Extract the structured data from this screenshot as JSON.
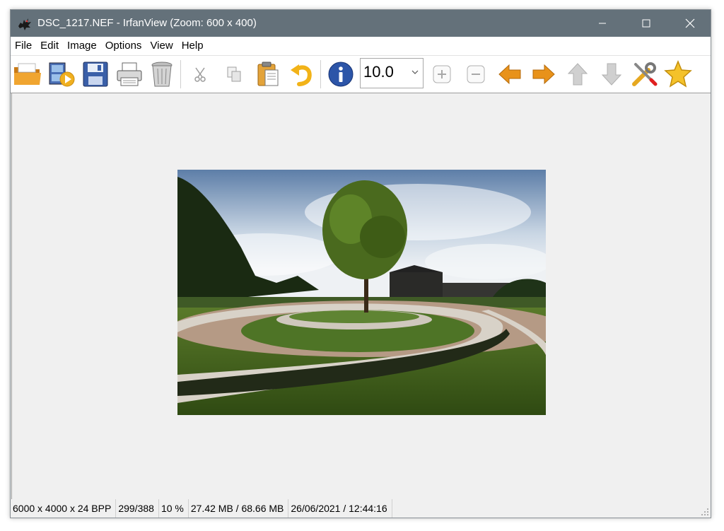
{
  "window": {
    "title": "DSC_1217.NEF - IrfanView (Zoom: 600 x 400)",
    "icon": "irfanview-cat-icon",
    "controls": [
      "minimize-icon",
      "maximize-icon",
      "close-icon"
    ]
  },
  "menu": {
    "items": [
      {
        "label": "File"
      },
      {
        "label": "Edit"
      },
      {
        "label": "Image"
      },
      {
        "label": "Options"
      },
      {
        "label": "View"
      },
      {
        "label": "Help"
      }
    ]
  },
  "toolbar": {
    "buttons": [
      {
        "icon": "open-folder-icon"
      },
      {
        "icon": "slideshow-icon"
      },
      {
        "icon": "save-floppy-icon"
      },
      {
        "icon": "print-icon"
      },
      {
        "icon": "delete-trash-icon"
      },
      {
        "icon": "cut-scissors-icon"
      },
      {
        "icon": "copy-icon"
      },
      {
        "icon": "paste-clipboard-icon"
      },
      {
        "icon": "undo-arrow-icon"
      },
      {
        "icon": "info-icon"
      },
      {
        "icon": "zoom-in-icon"
      },
      {
        "icon": "zoom-out-icon"
      },
      {
        "icon": "previous-arrow-icon"
      },
      {
        "icon": "next-arrow-icon"
      },
      {
        "icon": "up-arrow-icon"
      },
      {
        "icon": "down-arrow-icon"
      },
      {
        "icon": "properties-tools-icon"
      },
      {
        "icon": "favorites-star-icon"
      }
    ],
    "zoom_value": "10.0"
  },
  "image": {
    "description": "wide-angle photo of circular park lawn with tree"
  },
  "status": {
    "dimensions": "6000 x 4000 x 24 BPP",
    "index": "299/388",
    "zoom": "10 %",
    "memory": "27.42 MB / 68.66 MB",
    "datetime": "26/06/2021 / 12:44:16"
  },
  "colors": {
    "titlebar": "#64717a",
    "accent_orange": "#e8921a",
    "info_blue": "#2c55a8"
  }
}
